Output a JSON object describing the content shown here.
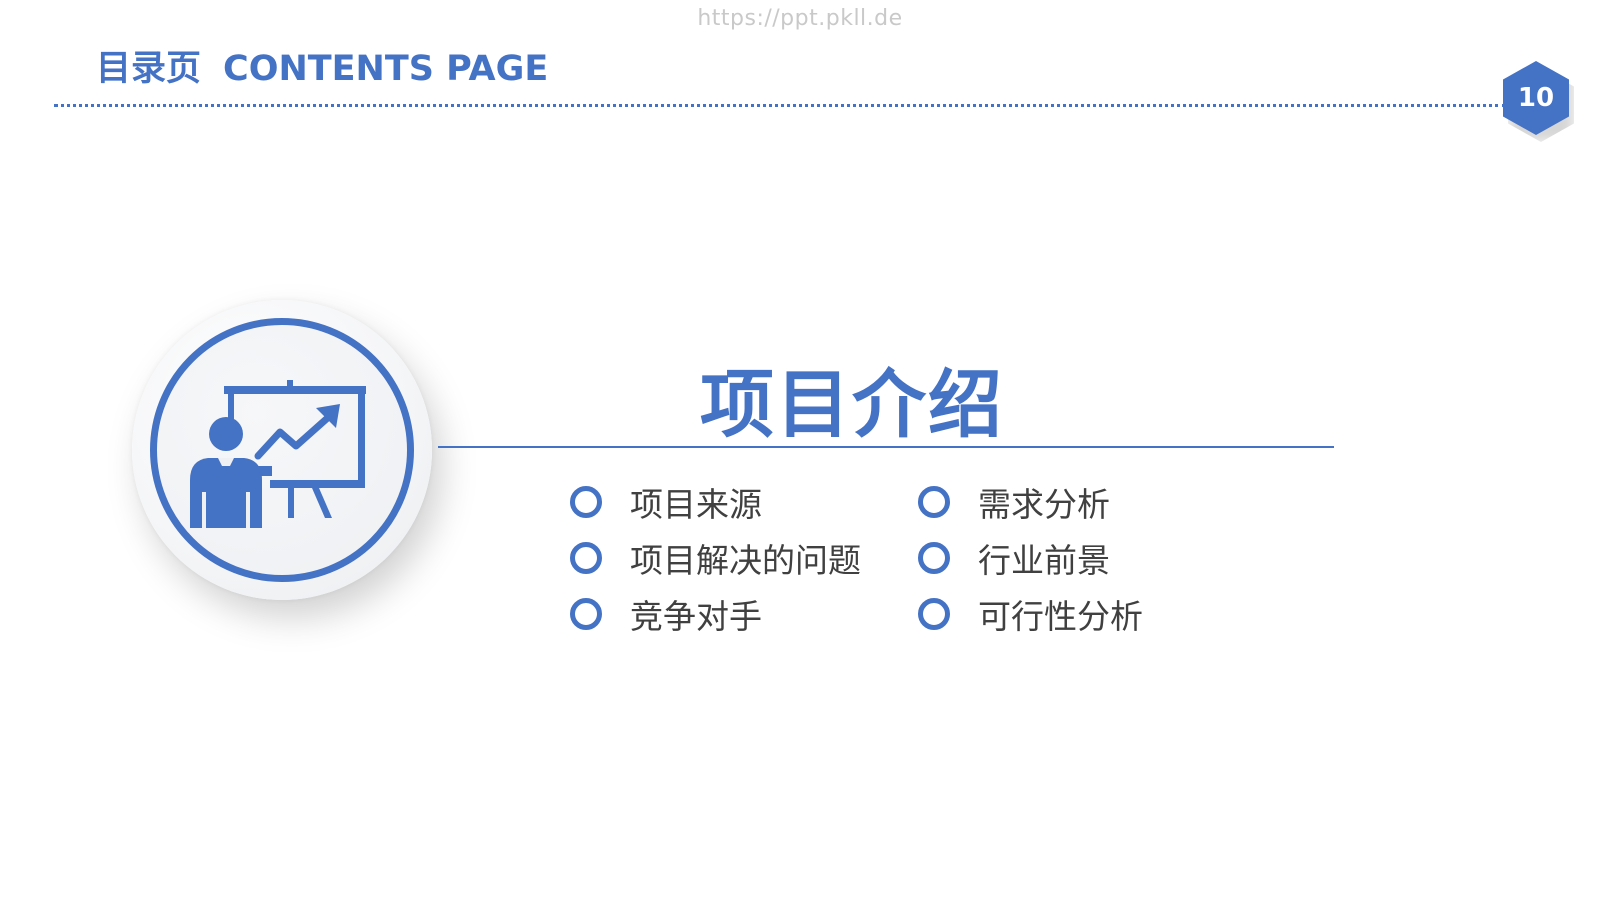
{
  "watermark": "https://ppt.pkll.de",
  "header": {
    "title_cn": "目录页",
    "title_en": "CONTENTS PAGE"
  },
  "page_number": "10",
  "section": {
    "title": "项目介绍",
    "icon": "presenter-chart-icon"
  },
  "items": [
    {
      "label": "项目来源"
    },
    {
      "label": "需求分析"
    },
    {
      "label": "项目解决的问题"
    },
    {
      "label": "行业前景"
    },
    {
      "label": "竞争对手"
    },
    {
      "label": "可行性分析"
    }
  ],
  "colors": {
    "accent": "#4472c4",
    "text": "#404040",
    "watermark": "#c9c9c9"
  }
}
